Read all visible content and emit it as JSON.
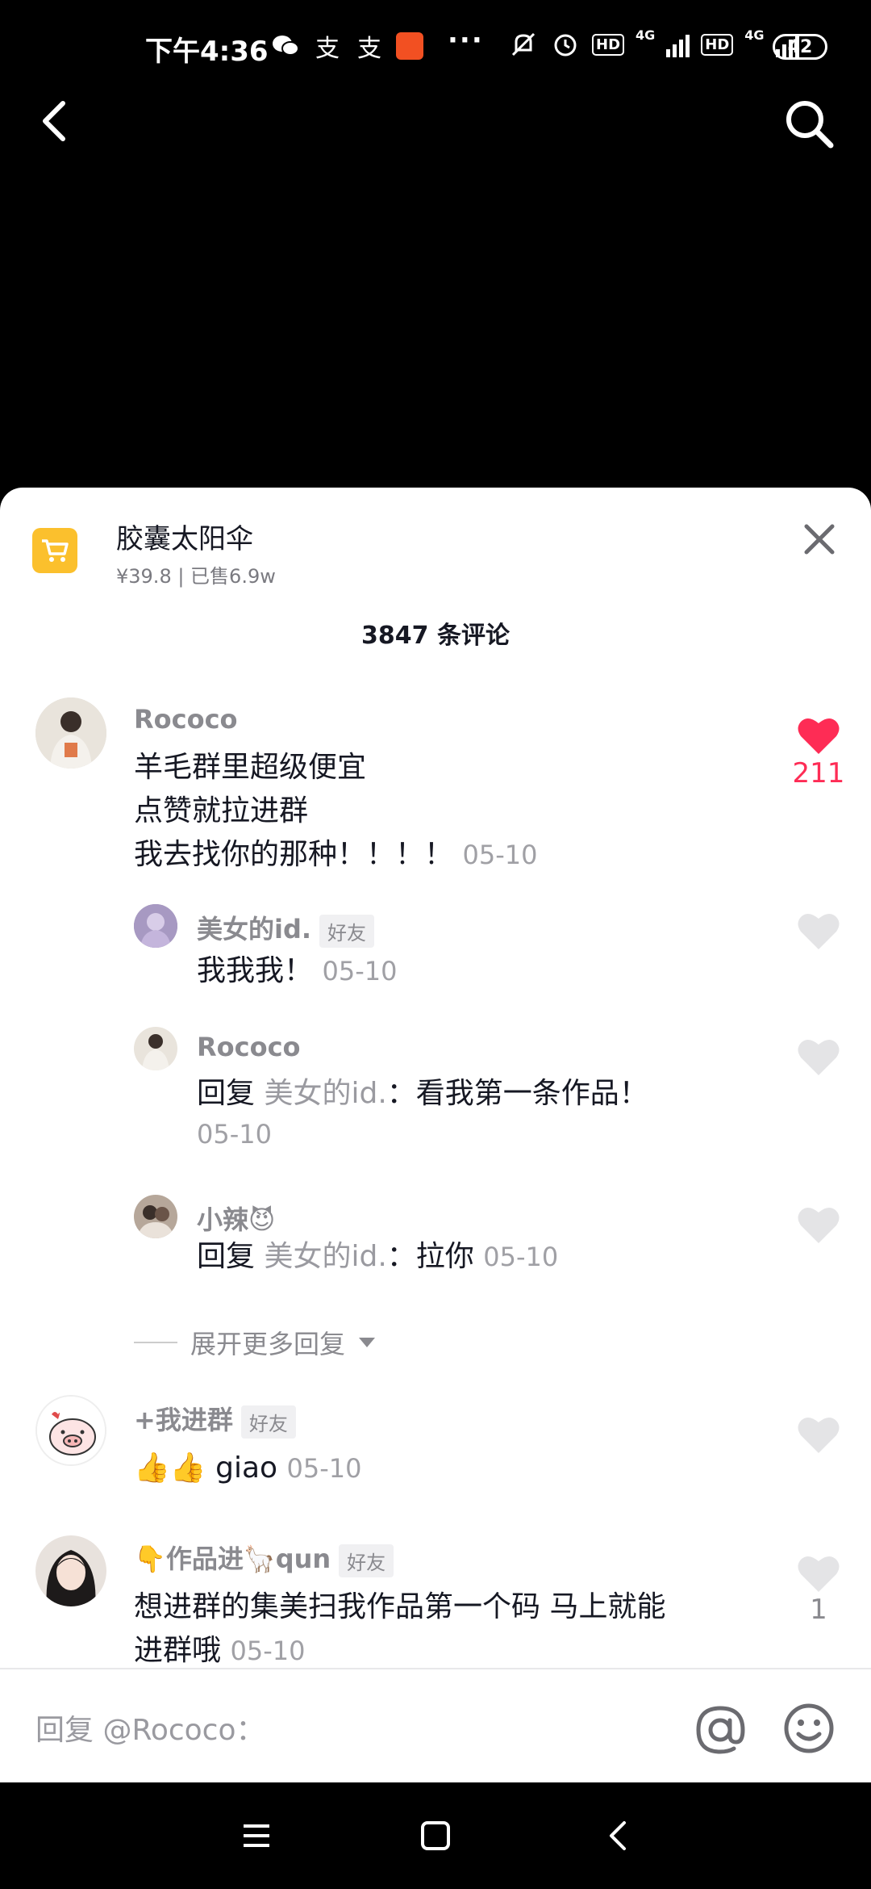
{
  "status_bar": {
    "time": "下午4:36",
    "app_icon_label": "支",
    "dots": "···",
    "network": "4G",
    "hd": "HD",
    "battery": "42"
  },
  "product": {
    "title": "胶囊太阳伞",
    "price_sales": "¥39.8 | 已售6.9w"
  },
  "comments_header": "3847 条评论",
  "comments": [
    {
      "username": "Rococo",
      "lines": [
        "羊毛群里超级便宜",
        "点赞就拉进群",
        "我去找你的那种！！！！"
      ],
      "date": "05-10",
      "likes": "211",
      "liked": true
    },
    {
      "username": "美女的id.",
      "badge": "好友",
      "text": "我我我！",
      "date": "05-10"
    },
    {
      "username": "Rococo",
      "reply_prefix": "回复",
      "reply_to": "美女的id.",
      "text": "：看我第一条作品！",
      "date": "05-10"
    },
    {
      "username": "小辣😈",
      "reply_prefix": "回复",
      "reply_to": "美女的id.",
      "text": "：拉你",
      "date": "05-10"
    },
    {
      "username": "+我进群",
      "badge": "好友",
      "text": "👍👍 giao",
      "date": "05-10"
    },
    {
      "username": "👇作品进🦙qun",
      "badge": "好友",
      "lines": [
        "想进群的集美扫我作品第一个码 马上就能",
        "进群哦"
      ],
      "date": "05-10",
      "likes": "1"
    }
  ],
  "expand_replies": "展开更多回复",
  "input": {
    "placeholder": "回复 @Rococo："
  },
  "colors": {
    "accent_like": "#fe2c55",
    "unliked": "#e4e4e6",
    "cart": "#fbc02d"
  }
}
